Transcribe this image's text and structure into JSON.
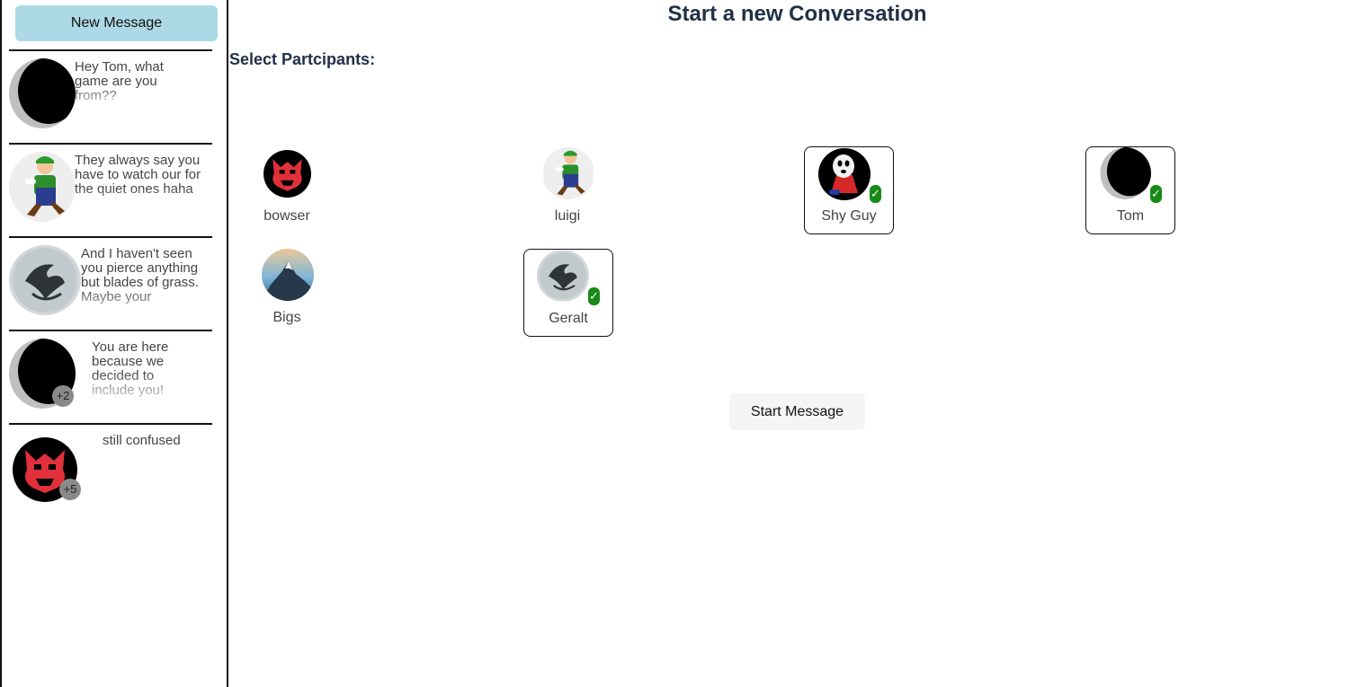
{
  "sidebar": {
    "new_message_label": "New Message",
    "conversations": [
      {
        "avatar": "moon-avatar-icon",
        "preview": "Hey Tom, what game are you from??",
        "extra_count": ""
      },
      {
        "avatar": "luigi-avatar-icon",
        "preview": "They always say you have to watch our for the quiet ones haha",
        "extra_count": ""
      },
      {
        "avatar": "wolf-avatar-icon",
        "preview": "And I haven't seen you pierce anything but blades of grass. Maybe your",
        "extra_count": ""
      },
      {
        "avatar": "moon-avatar-icon",
        "preview": "You are here because we decided to include you!",
        "extra_count": "+2"
      },
      {
        "avatar": "bowser-avatar-icon",
        "preview": "still confused",
        "extra_count": "+5"
      }
    ]
  },
  "main": {
    "title": "Start a new Conversation",
    "select_label": "Select Partcipants:",
    "participants": [
      {
        "name": "bowser",
        "avatar": "bowser-avatar-icon",
        "selected": false
      },
      {
        "name": "luigi",
        "avatar": "luigi-avatar-icon",
        "selected": false
      },
      {
        "name": "Shy Guy",
        "avatar": "shyguy-avatar-icon",
        "selected": true
      },
      {
        "name": "Tom",
        "avatar": "moon-avatar-icon",
        "selected": true
      },
      {
        "name": "Bigs",
        "avatar": "mountain-avatar-icon",
        "selected": false
      },
      {
        "name": "Geralt",
        "avatar": "wolf-avatar-icon",
        "selected": true
      }
    ],
    "check_glyph": "✓",
    "start_button_label": "Start Message"
  },
  "colors": {
    "new_message_bg": "#add8e6",
    "title_color": "#213047",
    "check_green": "#178a17",
    "divider": "#111111"
  }
}
